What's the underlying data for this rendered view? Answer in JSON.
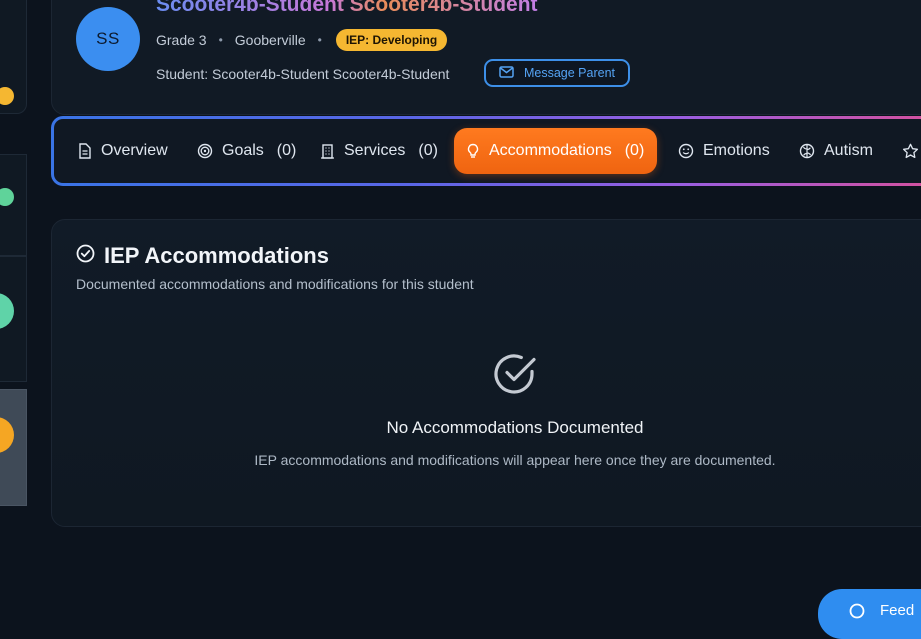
{
  "student": {
    "initials": "SS",
    "name": "Scooter4b-Student Scooter4b-Student",
    "grade": "Grade 3",
    "school": "Gooberville",
    "iep_badge": "IEP: Developing",
    "student_line": "Student: Scooter4b-Student Scooter4b-Student",
    "message_button": "Message Parent"
  },
  "tabs": [
    {
      "label": "Overview",
      "count": "",
      "icon": "document-icon"
    },
    {
      "label": "Goals",
      "count": "(0)",
      "icon": "target-icon"
    },
    {
      "label": "Services",
      "count": "(0)",
      "icon": "building-icon"
    },
    {
      "label": "Accommodations",
      "count": "(0)",
      "icon": "lightbulb-icon",
      "active": true
    },
    {
      "label": "Emotions",
      "count": "",
      "icon": "smile-icon"
    },
    {
      "label": "Autism",
      "count": "",
      "icon": "brain-icon"
    },
    {
      "label": "",
      "count": "",
      "icon": "star-icon"
    }
  ],
  "accommodations": {
    "title": "IEP Accommodations",
    "subtitle": "Documented accommodations and modifications for this student",
    "empty_title": "No Accommodations Documented",
    "empty_desc": "IEP accommodations and modifications will appear here once they are documented."
  },
  "feedback_button": "Feed",
  "colors": {
    "accent_orange": "#f26a12",
    "accent_blue": "#3b8ef0",
    "badge_yellow": "#f5b731",
    "background": "#0c131d"
  }
}
